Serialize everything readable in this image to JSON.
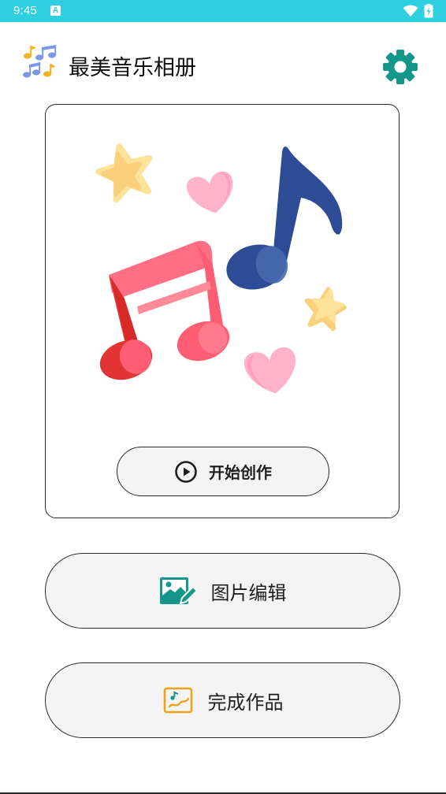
{
  "status_bar": {
    "time": "9:45",
    "notification_icon": "A",
    "icons": [
      "notification-a-icon",
      "wifi-icon",
      "battery-charging-icon"
    ],
    "background": "#2ecfdf"
  },
  "header": {
    "title": "最美音乐相册",
    "logo_icon": "music-notes-logo-icon",
    "settings_icon": "gear-icon",
    "accent_color": "#14978a"
  },
  "hero_card": {
    "illustration_icon": "music-notes-hearts-stars-illustration",
    "start_button": {
      "label": "开始创作",
      "icon": "play-circle-icon"
    }
  },
  "actions": {
    "photo_edit": {
      "label": "图片编辑",
      "icon": "image-edit-icon",
      "icon_color": "#14978a"
    },
    "finished_works": {
      "label": "完成作品",
      "icon": "artwork-chart-icon",
      "icon_color": "#f0a11a"
    }
  }
}
